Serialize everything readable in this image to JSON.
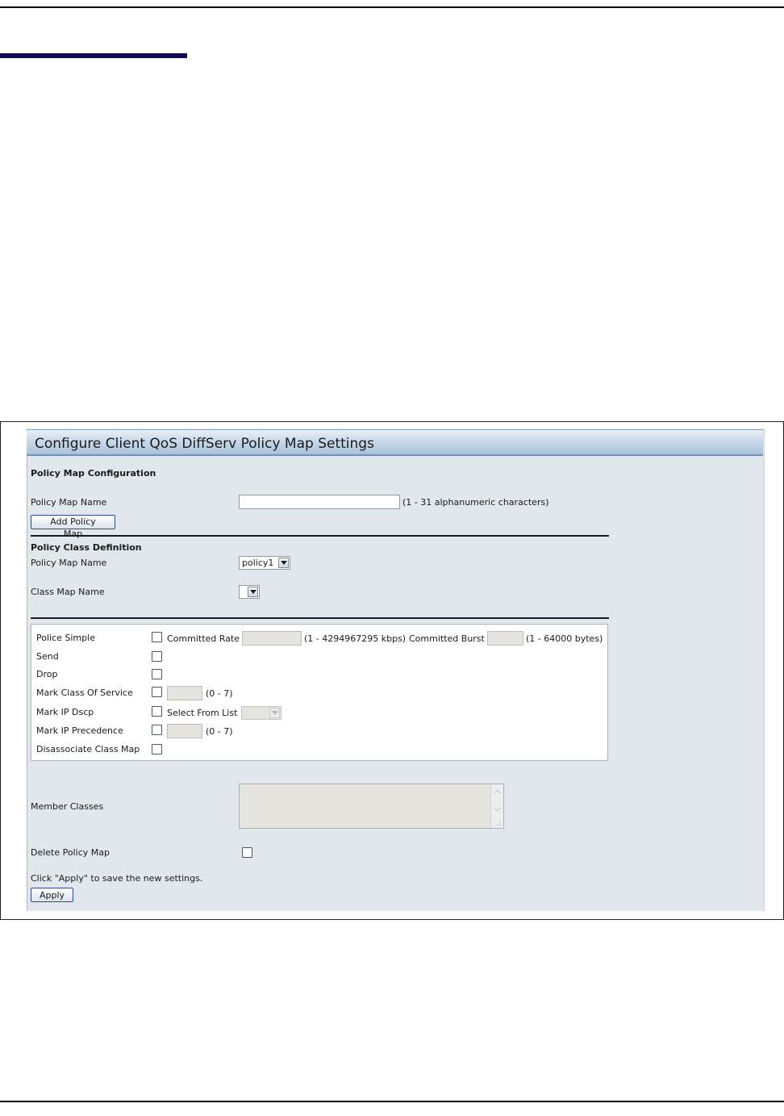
{
  "window": {
    "title": "Configure Client QoS DiffServ Policy Map Settings"
  },
  "policy_map_configuration": {
    "heading": "Policy Map Configuration",
    "name_label": "Policy Map Name",
    "name_value": "",
    "name_hint": "(1 - 31 alphanumeric characters)",
    "add_button": "Add Policy Map"
  },
  "policy_class_definition": {
    "heading": "Policy Class Definition",
    "policy_map_label": "Policy Map Name",
    "policy_map_selected": "policy1",
    "class_map_label": "Class Map Name",
    "class_map_selected": ""
  },
  "actions": {
    "police_simple": {
      "label": "Police Simple",
      "checked": false,
      "committed_rate_label": "Committed Rate",
      "committed_rate_value": "",
      "committed_rate_hint": "(1 - 4294967295 kbps)",
      "committed_burst_label": "Committed Burst",
      "committed_burst_value": "",
      "committed_burst_hint": "(1 - 64000 bytes)"
    },
    "send": {
      "label": "Send",
      "checked": false
    },
    "drop": {
      "label": "Drop",
      "checked": false
    },
    "mark_cos": {
      "label": "Mark Class Of Service",
      "checked": false,
      "value": "",
      "hint": "(0 - 7)"
    },
    "mark_dscp": {
      "label": "Mark IP Dscp",
      "checked": false,
      "select_label": "Select From List",
      "selected": ""
    },
    "mark_precedence": {
      "label": "Mark IP Precedence",
      "checked": false,
      "value": "",
      "hint": "(0 - 7)"
    },
    "disassociate": {
      "label": "Disassociate Class Map",
      "checked": false
    }
  },
  "member_classes": {
    "label": "Member Classes",
    "value": ""
  },
  "delete_policy_map": {
    "label": "Delete Policy Map",
    "checked": false
  },
  "footer": {
    "note": "Click \"Apply\" to save the new settings.",
    "apply_button": "Apply"
  },
  "colors": {
    "panel_bg": "#e1e7ec",
    "header_gradient_top": "#e8f0f8",
    "header_gradient_bottom": "#aac2db",
    "accent_bar": "#0b0b4d",
    "disabled_field": "#e6e4de"
  }
}
